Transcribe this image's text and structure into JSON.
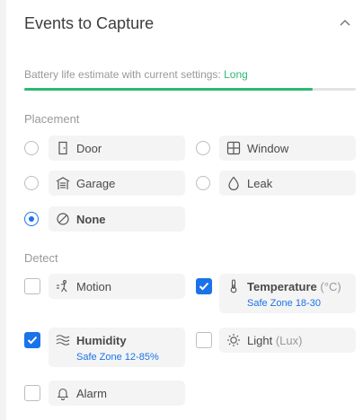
{
  "header": {
    "title": "Events to Capture",
    "collapse_icon": "chevron-up-icon"
  },
  "battery": {
    "text": "Battery life estimate with current settings:",
    "level": "Long",
    "fill_fraction": 0.87,
    "color": "#2eb872"
  },
  "placement": {
    "title": "Placement",
    "options": [
      {
        "label": "Door",
        "icon": "door-icon",
        "selected": false
      },
      {
        "label": "Window",
        "icon": "window-icon",
        "selected": false
      },
      {
        "label": "Garage",
        "icon": "garage-icon",
        "selected": false
      },
      {
        "label": "Leak",
        "icon": "droplet-icon",
        "selected": false
      },
      {
        "label": "None",
        "icon": "none-icon",
        "selected": true
      }
    ]
  },
  "detect": {
    "title": "Detect",
    "options": [
      {
        "label": "Motion",
        "icon": "motion-icon",
        "checked": false
      },
      {
        "label": "Temperature",
        "unit": "(°C)",
        "icon": "thermometer-icon",
        "checked": true,
        "sub": "Safe Zone 18-30"
      },
      {
        "label": "Humidity",
        "icon": "humidity-icon",
        "checked": true,
        "sub": "Safe Zone 12-85%"
      },
      {
        "label": "Light",
        "unit": "(Lux)",
        "icon": "sun-icon",
        "checked": false
      },
      {
        "label": "Alarm",
        "icon": "bell-icon",
        "checked": false
      }
    ]
  },
  "accent_color": "#1a73e8"
}
